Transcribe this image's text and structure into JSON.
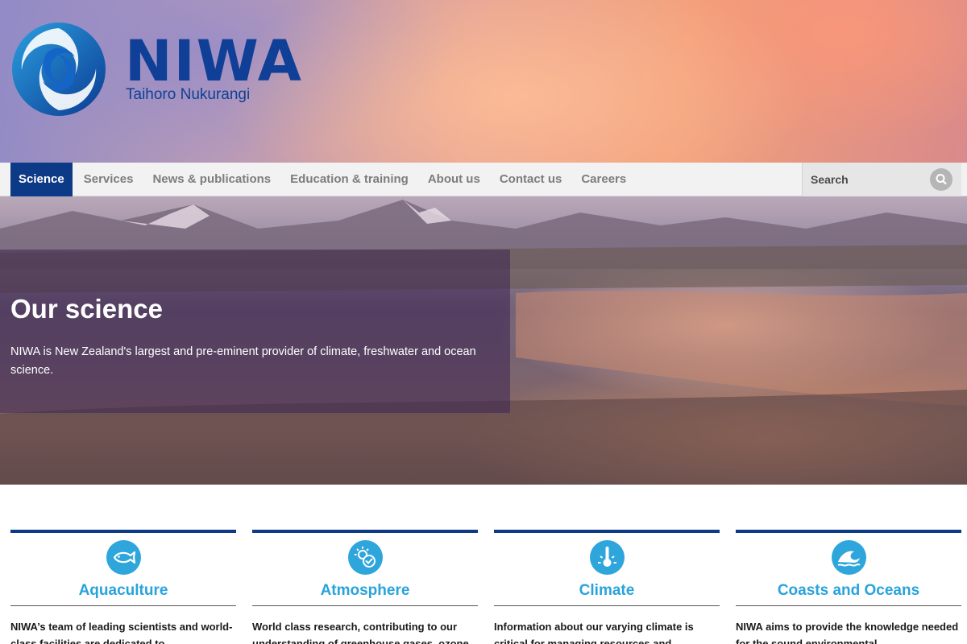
{
  "brand": {
    "name": "NIWA",
    "tagline": "Taihoro Nukurangi",
    "color_primary": "#0d3a87",
    "color_accent": "#2ea6dc"
  },
  "nav": {
    "items": [
      {
        "label": "Science",
        "active": true
      },
      {
        "label": "Services",
        "active": false
      },
      {
        "label": "News & publications",
        "active": false
      },
      {
        "label": "Education & training",
        "active": false
      },
      {
        "label": "About us",
        "active": false
      },
      {
        "label": "Contact us",
        "active": false
      },
      {
        "label": "Careers",
        "active": false
      }
    ],
    "search": {
      "placeholder": "Search",
      "icon": "search-icon"
    }
  },
  "hero": {
    "title": "Our science",
    "text": "NIWA is New Zealand's largest and pre-eminent provider of climate, freshwater and ocean science."
  },
  "cards": [
    {
      "title": "Aquaculture",
      "icon": "fish-icon",
      "text": "NIWA’s team of leading scientists and world-class facilities are dedicated to"
    },
    {
      "title": "Atmosphere",
      "icon": "sun-cloud-icon",
      "text": "World class research, contributing to our understanding of greenhouse gases, ozone"
    },
    {
      "title": "Climate",
      "icon": "thermometer-icon",
      "text": "Information about our varying climate is critical for managing resources and"
    },
    {
      "title": "Coasts and Oceans",
      "icon": "wave-icon",
      "text": "NIWA aims to provide the knowledge needed for the sound environmental"
    }
  ]
}
